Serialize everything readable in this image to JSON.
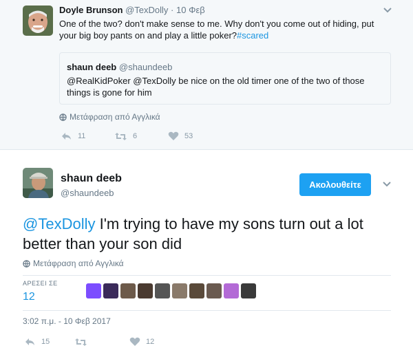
{
  "tweet1": {
    "author_name": "Doyle Brunson",
    "author_handle": "@TexDolly",
    "date": "10 Φεβ",
    "text": "One of the two? don't make sense to me. Why don't you come out of hiding, put your big boy pants on and play a little poker?",
    "hashtag": "#scared",
    "quote": {
      "author_name": "shaun deeb",
      "author_handle": "@shaundeeb",
      "text": "@RealKidPoker @TexDolly be nice on the old timer one of the two of those things is gone for him"
    },
    "translate_label": "Μετάφραση από Αγγλικά",
    "replies": "11",
    "retweets": "6",
    "likes": "53"
  },
  "tweet2": {
    "author_name": "shaun deeb",
    "author_handle": "@shaundeeb",
    "follow_label": "Ακολουθείτε",
    "mention": "@TexDolly",
    "text": " I'm trying to have my sons turn out a lot better than your son did",
    "translate_label": "Μετάφραση από Αγγλικά",
    "likes_label": "ΑΡΕΣΕΙ ΣΕ",
    "likes_count": "12",
    "likers": [
      "#7c4dff",
      "#3b2a5a",
      "#6d5a4a",
      "#4a3a30",
      "#555555",
      "#8a7a6a",
      "#5a4a3a",
      "#6a5a50",
      "#b36ad6",
      "#3a3a3a"
    ],
    "timestamp": "3:02 π.μ. - 10 Φεβ 2017",
    "replies": "15",
    "retweets": "",
    "likes": "12"
  },
  "colors": {
    "link": "#1b95e0",
    "follow_button": "#1da1f2",
    "top_background": "#f5f8fa"
  }
}
